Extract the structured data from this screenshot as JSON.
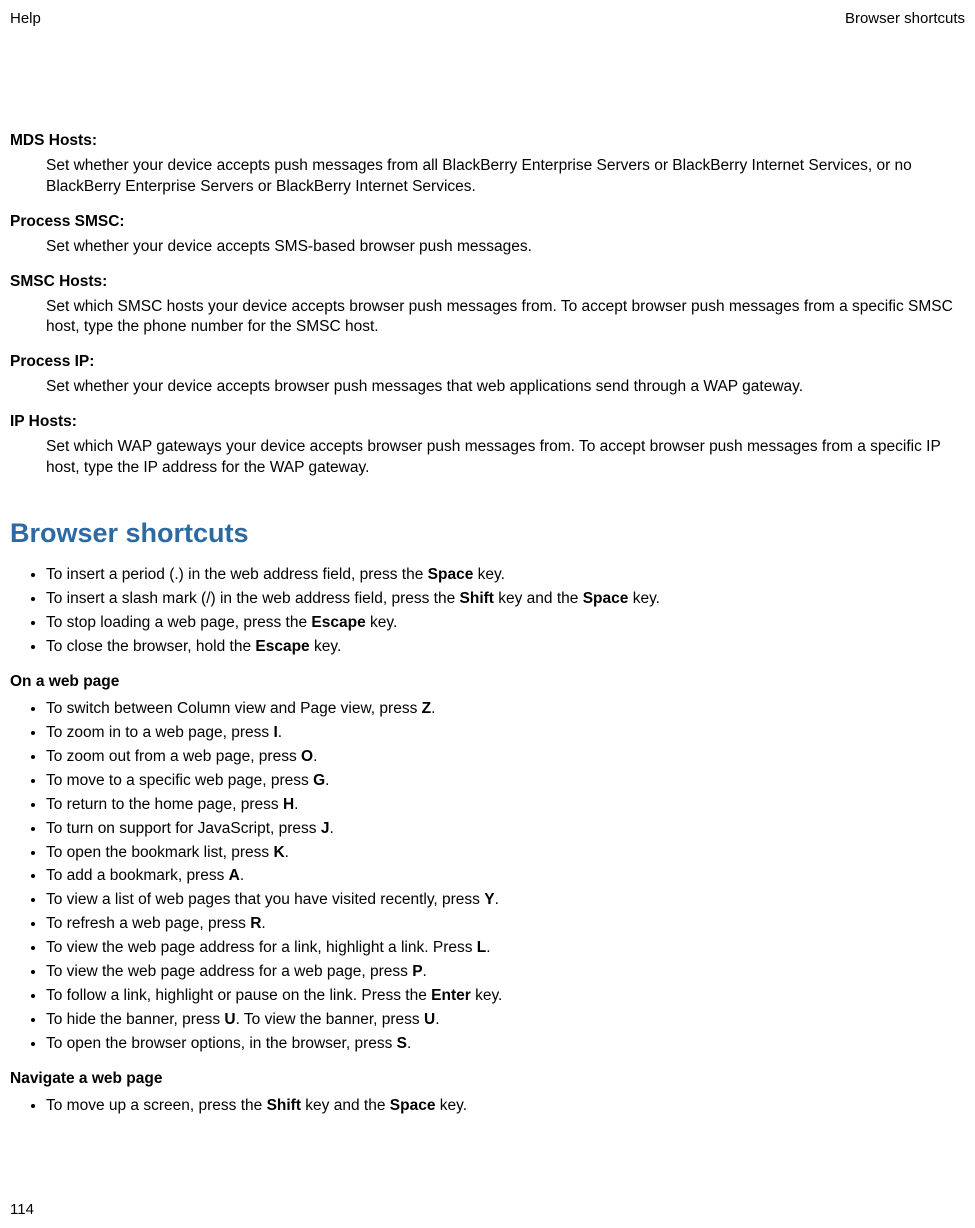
{
  "header": {
    "left": "Help",
    "right": "Browser shortcuts"
  },
  "definitions": [
    {
      "term": "MDS Hosts:",
      "desc": "Set whether your device accepts push messages from all BlackBerry Enterprise Servers or BlackBerry Internet Services, or no BlackBerry Enterprise Servers or BlackBerry Internet Services."
    },
    {
      "term": "Process SMSC:",
      "desc": "Set whether your device accepts SMS-based browser push messages."
    },
    {
      "term": "SMSC Hosts:",
      "desc": "Set which SMSC hosts your device accepts browser push messages from. To accept browser push messages from a specific SMSC host, type the phone number for the SMSC host."
    },
    {
      "term": "Process IP:",
      "desc": "Set whether your device accepts browser push messages that web applications send through a WAP gateway."
    },
    {
      "term": "IP Hosts:",
      "desc": "Set which WAP gateways your device accepts browser push messages from. To accept browser push messages from a specific IP host, type the IP address for the WAP gateway."
    }
  ],
  "section_title": "Browser shortcuts",
  "shortcuts_general": [
    "To insert a period (.) in the web address field, press the |Space| key.",
    "To insert a slash mark (/) in the web address field, press the |Shift| key and the |Space| key.",
    "To stop loading a web page, press the |Escape| key.",
    "To close the browser, hold the |Escape| key."
  ],
  "subhead_onpage": "On a web page",
  "shortcuts_onpage": [
    "To switch between Column view and Page view, press |Z|.",
    "To zoom in to a web page, press |I|.",
    "To zoom out from a web page, press |O|.",
    "To move to a specific web page, press |G|.",
    "To return to the home page, press |H|.",
    "To turn on support for JavaScript, press |J|.",
    "To open the bookmark list, press |K|.",
    "To add a bookmark, press |A|.",
    "To view a list of web pages that you have visited recently, press |Y|.",
    "To refresh a web page, press |R|.",
    "To view the web page address for a link, highlight a link. Press |L|.",
    "To view the web page address for a web page, press |P|.",
    "To follow a link, highlight or pause on the link. Press the |Enter| key.",
    "To hide the banner, press |U|. To view the banner, press |U|.",
    "To open the browser options, in the browser, press |S|."
  ],
  "subhead_navigate": "Navigate a web page",
  "shortcuts_navigate": [
    "To move up a screen, press the |Shift| key and the |Space| key."
  ],
  "page_number": "114"
}
